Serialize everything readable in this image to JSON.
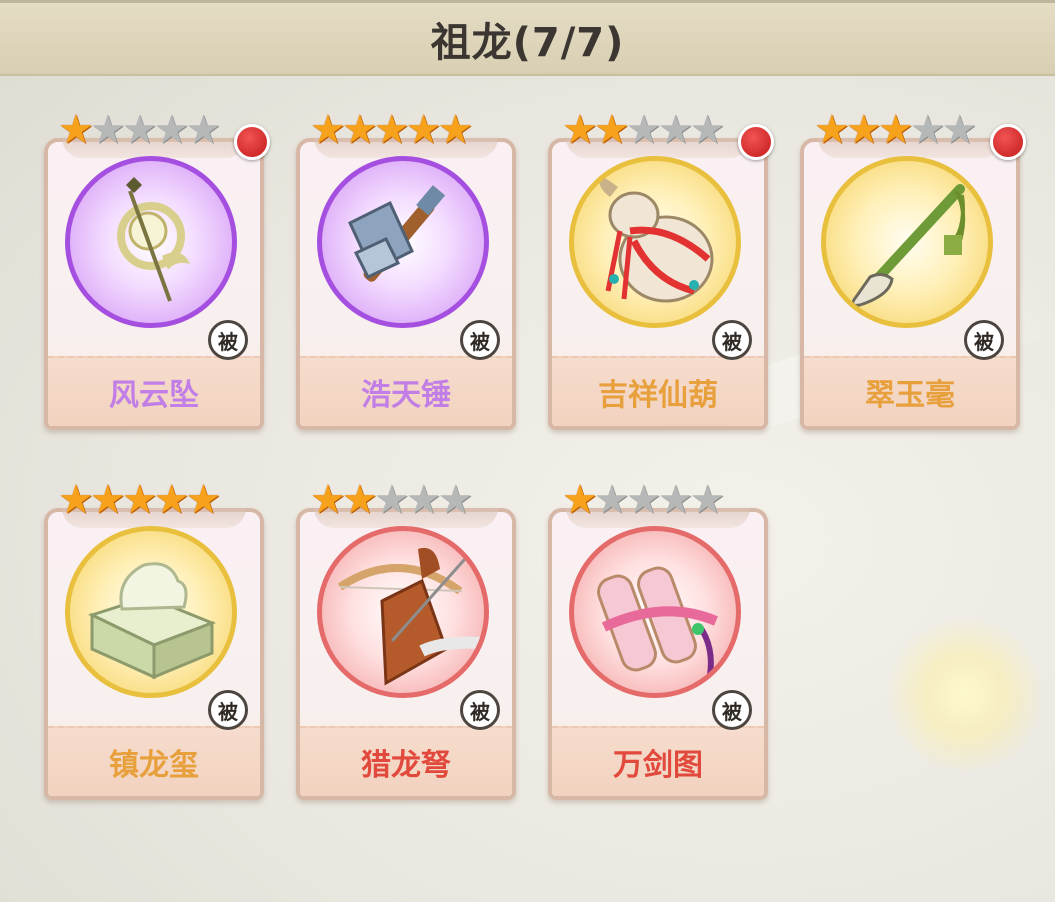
{
  "header": {
    "title": "祖龙(7/7)"
  },
  "badge_text": "被",
  "max_stars": 5,
  "colors": {
    "name_purple": "#c17ee6",
    "name_gold": "#e7a03c",
    "name_red": "#e2493d",
    "ring_purple": "#a54fe0",
    "ring_gold": "#e8c03e",
    "ring_red": "#e56a6a",
    "star_on": "#f7a21c",
    "star_off": "#b6b8b8"
  },
  "items": [
    {
      "name": "风云坠",
      "stars": 1,
      "rarity": "purple",
      "red_dot": true,
      "icon": "pendant-icon"
    },
    {
      "name": "浩天锤",
      "stars": 5,
      "rarity": "purple",
      "red_dot": false,
      "icon": "hammer-icon"
    },
    {
      "name": "吉祥仙葫",
      "stars": 2,
      "rarity": "gold",
      "red_dot": true,
      "icon": "gourd-icon"
    },
    {
      "name": "翠玉毫",
      "stars": 3,
      "rarity": "gold",
      "red_dot": true,
      "icon": "brush-icon"
    },
    {
      "name": "镇龙玺",
      "stars": 5,
      "rarity": "gold",
      "red_dot": false,
      "icon": "seal-icon"
    },
    {
      "name": "猎龙弩",
      "stars": 2,
      "rarity": "red",
      "red_dot": false,
      "icon": "crossbow-icon"
    },
    {
      "name": "万剑图",
      "stars": 1,
      "rarity": "red",
      "red_dot": false,
      "icon": "scroll-icon"
    }
  ]
}
